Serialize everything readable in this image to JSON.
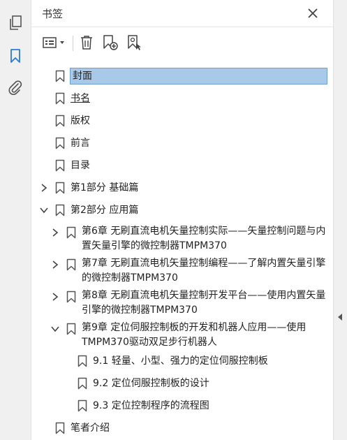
{
  "panel": {
    "title": "书签"
  },
  "rail": {
    "icons": [
      "pages-icon",
      "bookmark-icon",
      "attachment-icon"
    ]
  },
  "toolbar": {
    "icons": [
      "options-menu-icon",
      "delete-icon",
      "new-bookmark-icon",
      "bookmark-from-structure-icon"
    ]
  },
  "colors": {
    "selection": "#a9c9e8",
    "accent": "#2a7bd5"
  },
  "bookmarks": [
    {
      "label": "封面"
    },
    {
      "label": "书名"
    },
    {
      "label": "版权"
    },
    {
      "label": "前言"
    },
    {
      "label": "目录"
    },
    {
      "label": "第1部分  基础篇",
      "expanded": false
    },
    {
      "label": "第2部分  应用篇",
      "expanded": true
    },
    {
      "label": "第6章  无刷直流电机矢量控制实际——矢量控制问题与内置矢量引擎的微控制器TMPM370",
      "expanded": false
    },
    {
      "label": "第7章  无刷直流电机矢量控制编程——了解内置矢量引擎的微控制器TMPM370",
      "expanded": false
    },
    {
      "label": "第8章  无刷直流电机矢量控制开发平台——使用内置矢量引擎的微控制器TMPM370",
      "expanded": false
    },
    {
      "label": "第9章  定位伺服控制板的开发和机器人应用——使用TMPM370驱动双足步行机器人",
      "expanded": true
    },
    {
      "label": "9.1  轻量、小型、强力的定位伺服控制板"
    },
    {
      "label": "9.2  定位伺服控制板的设计"
    },
    {
      "label": "9.3  定位控制程序的流程图"
    },
    {
      "label": "笔者介绍"
    }
  ]
}
